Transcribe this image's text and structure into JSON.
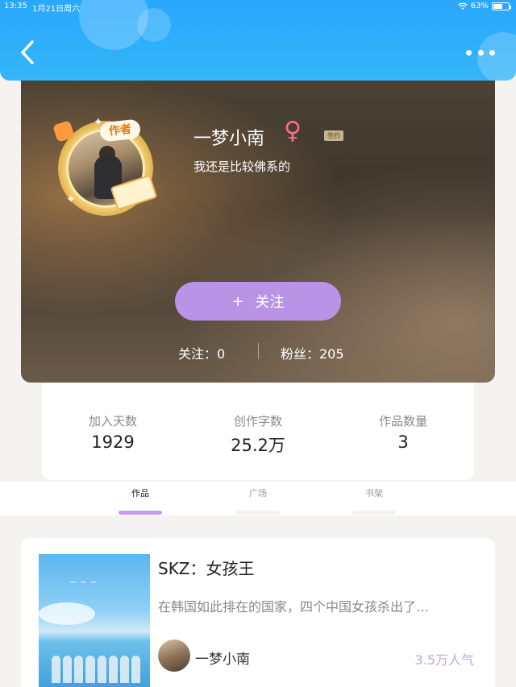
{
  "status_bar": {
    "time": "13:35",
    "date": "1月21日周六",
    "battery": "63%",
    "battery_level": 0.63
  },
  "header": {
    "back_icon": "chevron-left-icon",
    "more_icon": "more-horizontal-icon",
    "color": "#2aa7ff"
  },
  "profile": {
    "author_badge": "作者",
    "nickname": "一梦小南",
    "gender_icon": "female-icon",
    "sign_badge": "签约",
    "bio": "我还是比较佛系的",
    "follow_button": "关注",
    "follow_plus": "+",
    "following_label": "关注：0",
    "fans_label": "粉丝：205"
  },
  "stats": [
    {
      "label": "加入天数",
      "value": "1929"
    },
    {
      "label": "创作字数",
      "value": "25.2万"
    },
    {
      "label": "作品数量",
      "value": "3"
    }
  ],
  "tabs": [
    {
      "label": "作品",
      "active": true
    },
    {
      "label": "广场",
      "active": false
    },
    {
      "label": "书架",
      "active": false
    }
  ],
  "works": [
    {
      "title": "SKZ：女孩王",
      "description": "在韩国如此排在的国家，四个中国女孩杀出了…",
      "author": "一梦小南",
      "popularity": "3.5万人气"
    }
  ],
  "colors": {
    "accent": "#b993e6",
    "popularity": "#c4a3ec",
    "gender": "#ff6a93"
  }
}
